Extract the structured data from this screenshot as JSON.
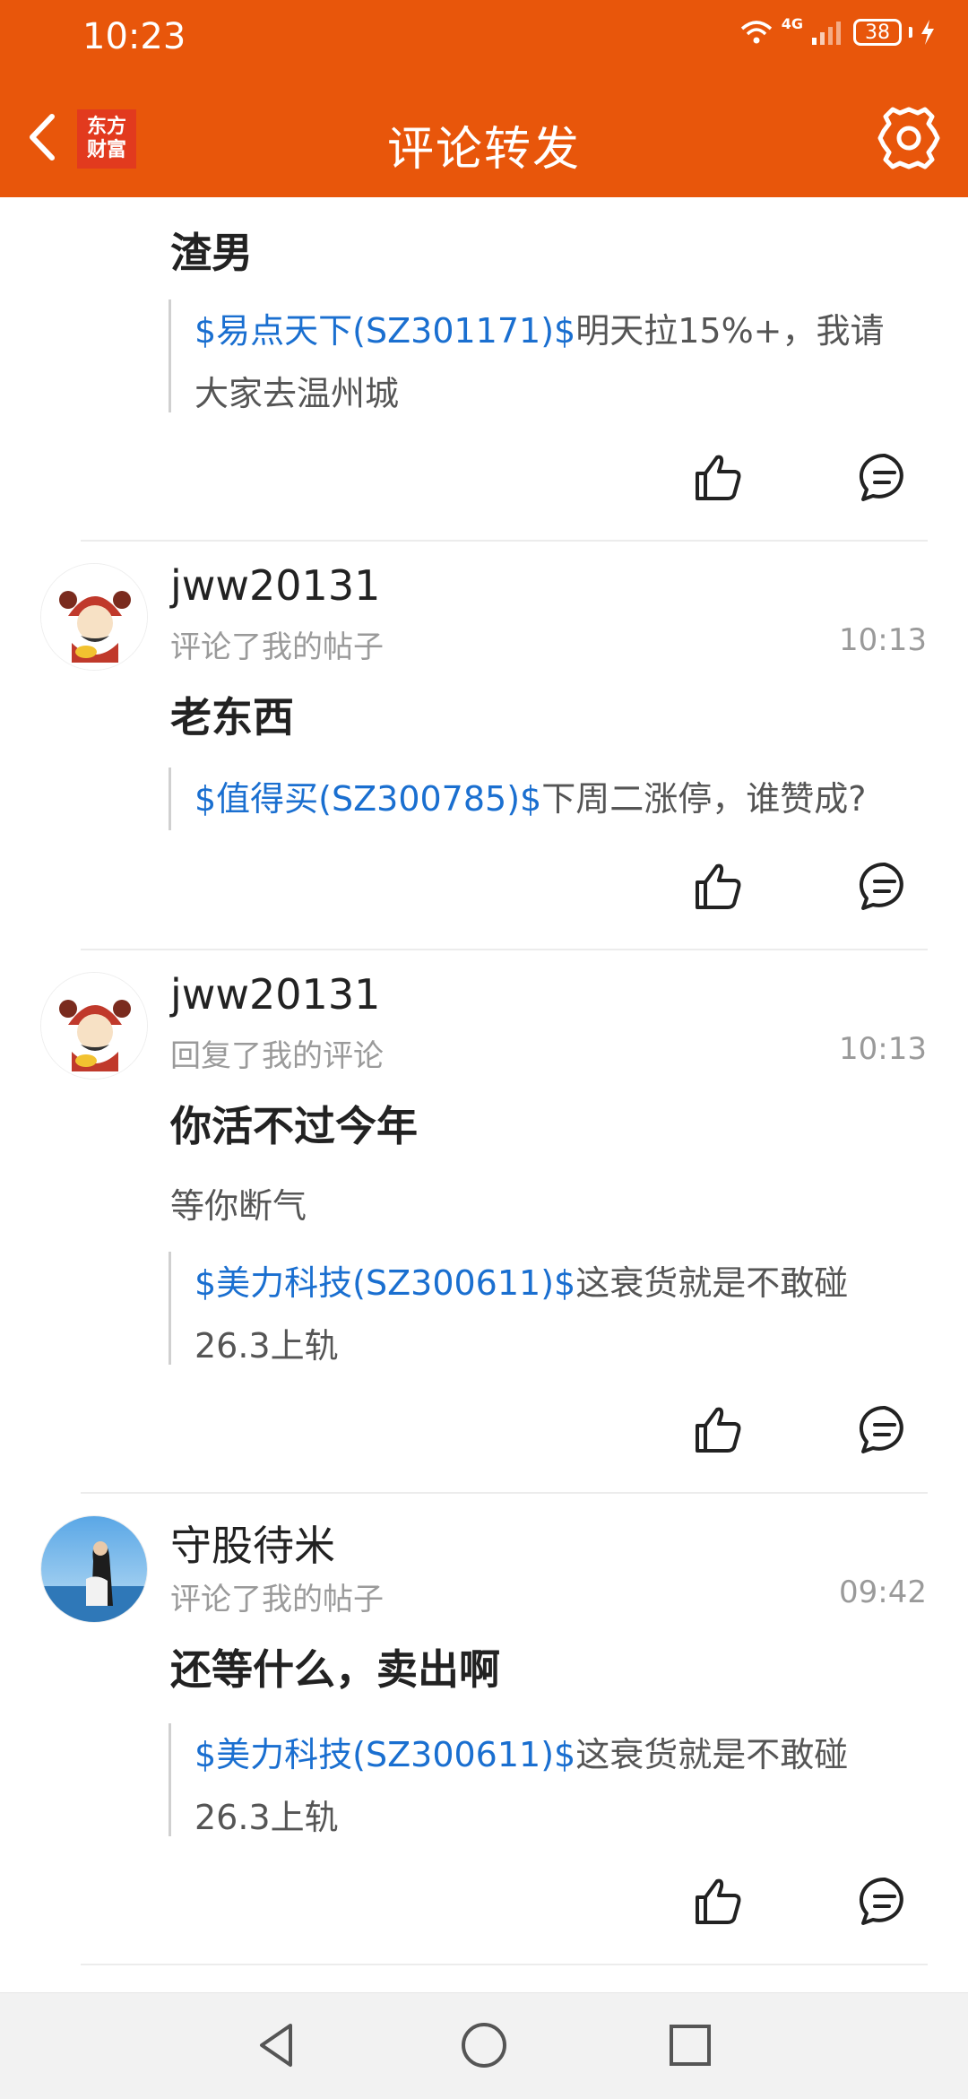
{
  "status": {
    "time": "10:23",
    "network": "4G",
    "battery": "38"
  },
  "header": {
    "title": "评论转发",
    "logo_line1": "东方",
    "logo_line2": "财富"
  },
  "posts": [
    {
      "comment": "渣男",
      "quote": {
        "stock": "$易点天下(SZ301171)$",
        "text": "明天拉15%+，我请大家去温州城"
      }
    },
    {
      "username": "jww20131",
      "action": "评论了我的帖子",
      "time": "10:13",
      "comment": "老东西",
      "quote": {
        "stock": "$值得买(SZ300785)$",
        "text": "下周二涨停，谁赞成?"
      }
    },
    {
      "username": "jww20131",
      "action": "回复了我的评论",
      "time": "10:13",
      "comment": "你活不过今年",
      "reply": "等你断气",
      "quote": {
        "stock": "$美力科技(SZ300611)$",
        "text": "这衰货就是不敢碰26.3上轨"
      }
    },
    {
      "username": "守股待米",
      "action": "评论了我的帖子",
      "time": "09:42",
      "comment": "还等什么，卖出啊",
      "quote": {
        "stock": "$美力科技(SZ300611)$",
        "text": "这衰货就是不敢碰26.3上轨"
      }
    }
  ],
  "icons": [
    "back-icon",
    "settings-icon",
    "like-icon",
    "reply-icon",
    "nav-back-icon",
    "nav-home-icon",
    "nav-recents-icon"
  ],
  "colors": {
    "brand": "#e8560b",
    "link": "#1a6fd0"
  }
}
